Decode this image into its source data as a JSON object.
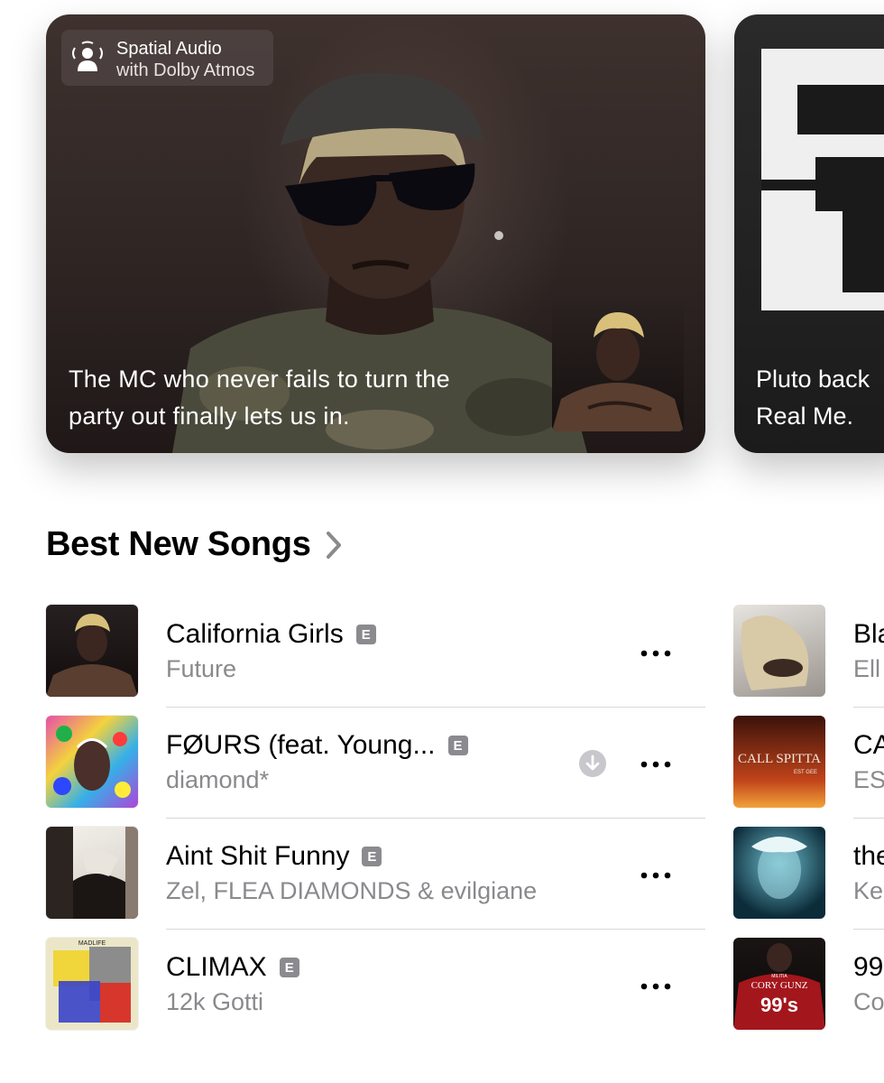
{
  "hero": {
    "badge": {
      "title": "Spatial Audio",
      "subtitle": "with Dolby Atmos",
      "icon": "spatial-audio-icon"
    },
    "caption_line1": "The MC who never fails to turn the",
    "caption_line2": "party out finally lets us in.",
    "next_caption_line1": "Pluto back",
    "next_caption_line2": "Real Me."
  },
  "section": {
    "title": "Best New Songs",
    "chevron_icon": "chevron-right-icon"
  },
  "songs": [
    {
      "title": "California Girls",
      "artist": "Future",
      "explicit": "E",
      "downloadable": false
    },
    {
      "title": "FØURS (feat. Young...",
      "artist": "diamond*",
      "explicit": "E",
      "downloadable": true
    },
    {
      "title": "Aint Shit Funny",
      "artist": "Zel, FLEA DIAMONDS & evilgiane",
      "explicit": "E",
      "downloadable": false
    },
    {
      "title": "CLIMAX",
      "artist": "12k Gotti",
      "explicit": "E",
      "downloadable": false
    }
  ],
  "songs_next_column": [
    {
      "title": "Bla",
      "artist": "Ell"
    },
    {
      "title": "CA",
      "artist": "ES"
    },
    {
      "title": "the",
      "artist": "Ke"
    },
    {
      "title": "99",
      "artist": "Co"
    }
  ],
  "album_art_text": {
    "climax_top": "MADLIFE",
    "call_spitta": "CALL SPITTA",
    "call_spitta_sub": "EST GEE",
    "cory_gunz_small": "MILITIA",
    "cory_gunz": "CORY GUNZ",
    "cory_gunz_num": "99's"
  },
  "colors": {
    "explicit_badge": "#8b8b8f",
    "secondary_text": "#8a8a8e",
    "separator": "#d8d8da"
  }
}
